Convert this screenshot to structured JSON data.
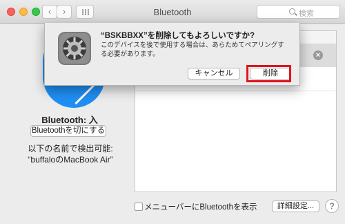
{
  "window": {
    "title": "Bluetooth"
  },
  "toolbar": {
    "back_icon": "chevron-left-icon",
    "forward_icon": "chevron-right-icon",
    "grid_icon": "show-all-grid-icon"
  },
  "search": {
    "placeholder": "検索"
  },
  "sidebar": {
    "bluetooth_state": "Bluetooth: 入",
    "toggle_button": "Bluetoothを切にする",
    "discoverable_label": "以下の名前で検出可能:",
    "computer_name": "“buffaloのMacBook Air”"
  },
  "device_list": {
    "remove_icon": "close-circle-icon"
  },
  "footer": {
    "show_in_menubar_label": "メニューバーにBluetoothを表示",
    "show_in_menubar_checked": false,
    "advanced_button": "詳細設定...",
    "help_button": "?"
  },
  "dialog": {
    "title": "“BSKBBXX”を削除してもよろしいですか?",
    "message": "このデバイスを後で使用する場合は、あらためてペアリングする必要があります。",
    "cancel_button": "キャンセル",
    "delete_button": "削除",
    "icon": "system-preferences-gear-icon"
  },
  "colors": {
    "highlight": "#e0141c",
    "bluetooth_blue": "#1f8ff4"
  }
}
